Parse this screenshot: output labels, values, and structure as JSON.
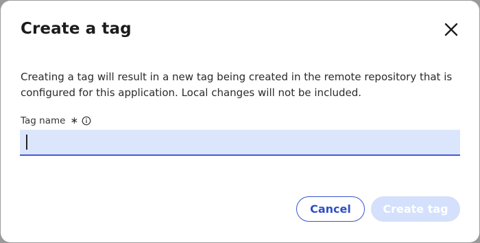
{
  "dialog": {
    "title": "Create a tag",
    "description": "Creating a tag will result in a new tag being created in the remote repository that is configured for this application. Local changes will not be included.",
    "field": {
      "label": "Tag name",
      "required_marker": "∗",
      "value": "",
      "info_icon": "info-circle-icon"
    },
    "buttons": {
      "cancel_label": "Cancel",
      "create_label": "Create tag",
      "create_enabled": false
    },
    "close_icon": "close-icon"
  },
  "colors": {
    "accent": "#3654c9",
    "input_background": "#dbe6fd",
    "disabled_button": "#d4e0fc"
  }
}
